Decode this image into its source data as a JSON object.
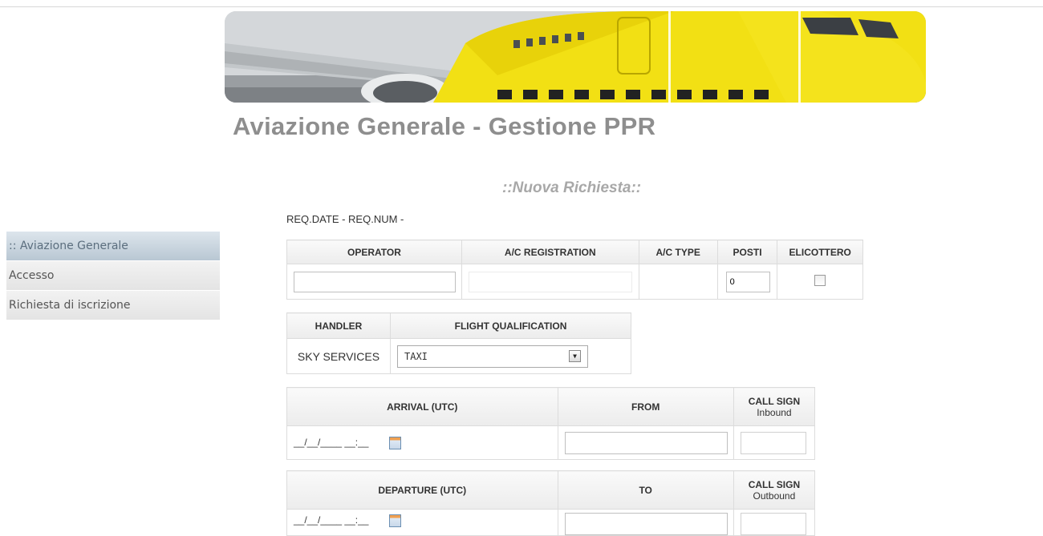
{
  "app": {
    "title": "Aviazione Generale - Gestione PPR",
    "section": "::Nuova Richiesta::",
    "req_line": "REQ.DATE - REQ.NUM -"
  },
  "sidebar": {
    "items": [
      {
        "label": ":: Aviazione Generale"
      },
      {
        "label": "Accesso"
      },
      {
        "label": "Richiesta di iscrizione"
      }
    ]
  },
  "aircraft": {
    "headers": [
      "OPERATOR",
      "A/C REGISTRATION",
      "A/C TYPE",
      "POSTI",
      "ELICOTTERO"
    ],
    "operator_value": "",
    "registration_value": "",
    "actype_value": "",
    "posti_value": "0",
    "elicottero_checked": false
  },
  "handler": {
    "headers": [
      "HANDLER",
      "FLIGHT QUALIFICATION"
    ],
    "handler_value": "SKY SERVICES",
    "qualification_selected": "TAXI"
  },
  "arrival": {
    "header": "ARRIVAL (UTC)",
    "from_header": "FROM",
    "callsign_header_1": "CALL SIGN",
    "callsign_header_2": "Inbound",
    "date_mask": "__/__/____ __:__"
  },
  "departure": {
    "header": "DEPARTURE (UTC)",
    "to_header": "TO",
    "callsign_header_1": "CALL SIGN",
    "callsign_header_2": "Outbound",
    "date_mask": "__/__/____ __:__"
  },
  "colors": {
    "title": "#8e8e8e",
    "sidebar_header": "#b9c7d3",
    "aircraft_livery": "#f2e014"
  },
  "icons": {
    "calendar": "calendar-icon",
    "dropdown": "chevron-down-icon"
  }
}
